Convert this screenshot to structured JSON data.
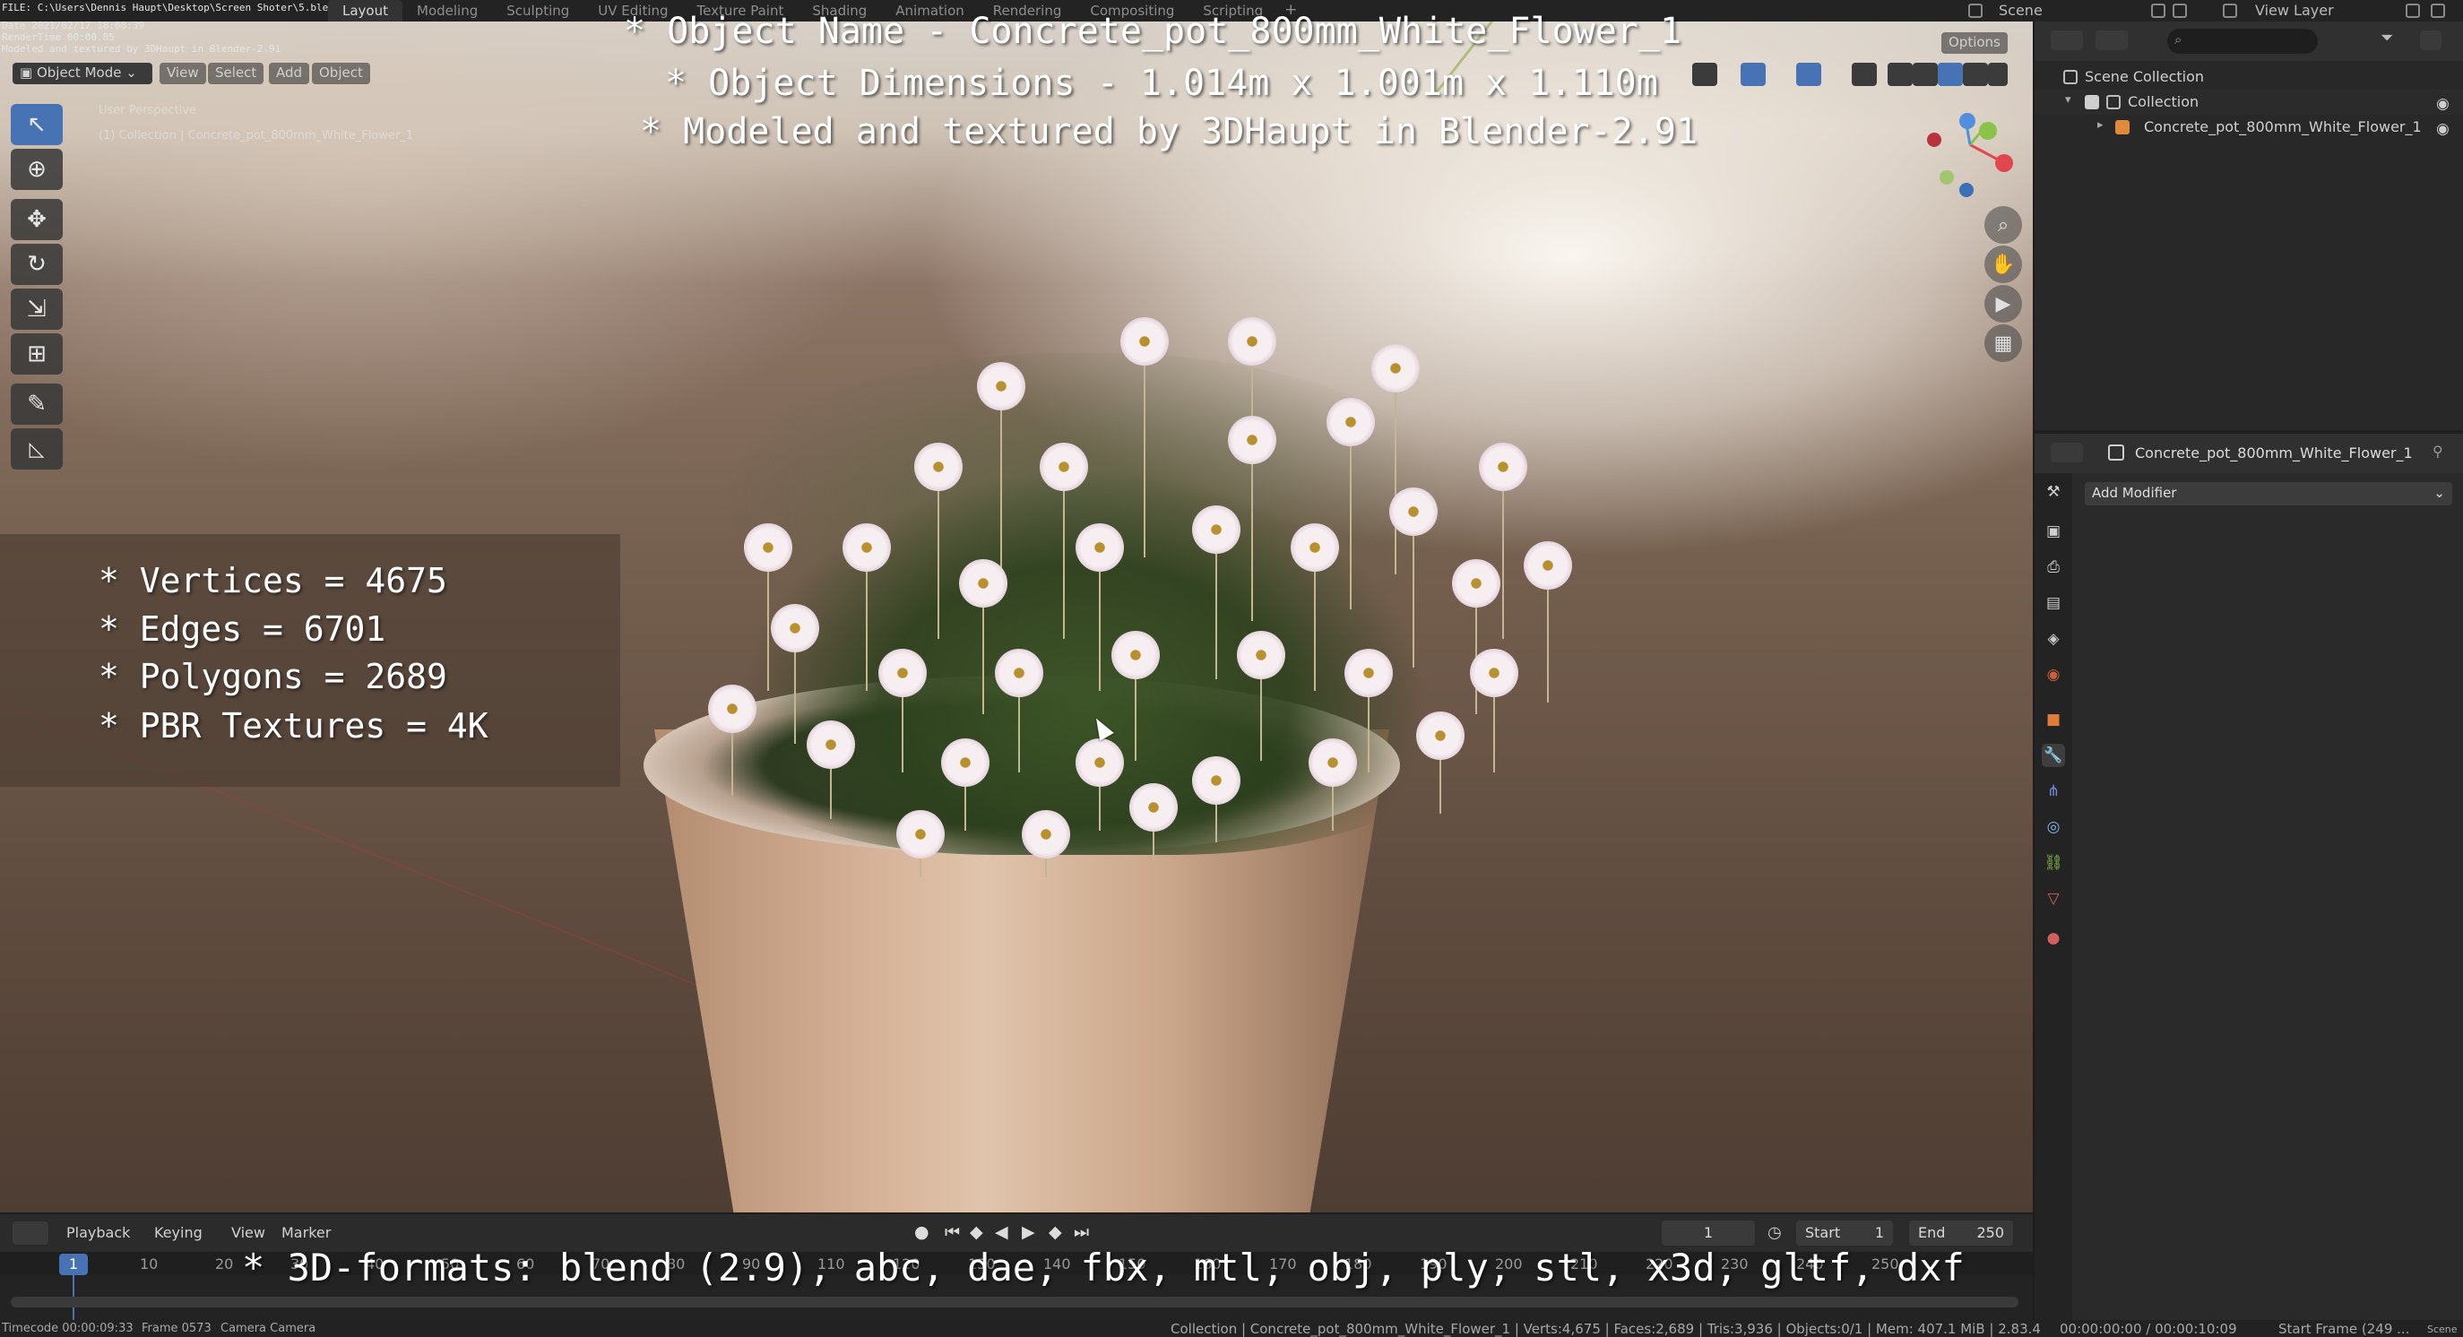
{
  "topbar": {
    "file_info": [
      "FILE: C:\\Users\\Dennis Haupt\\Desktop\\Screen Shoter\\5.blend",
      "Date 2021/02/17 18:08:39",
      "RenderTime 00:00.85",
      "Modeled and textured by 3DHaupt in Blender-2.91"
    ],
    "workspaces": [
      "Layout",
      "Modeling",
      "Sculpting",
      "UV Editing",
      "Texture Paint",
      "Shading",
      "Animation",
      "Rendering",
      "Compositing",
      "Scripting"
    ],
    "active_workspace": "Layout",
    "add_workspace": "+",
    "scene": "Scene",
    "view_layer": "View Layer"
  },
  "viewport": {
    "mode": "Object Mode",
    "menus": [
      "View",
      "Select",
      "Add",
      "Object"
    ],
    "options": "Options",
    "perspective_label": "User Perspective",
    "collection_label": "(1) Collection | Concrete_pot_800mm_White_Flower_1"
  },
  "overlay": {
    "title": "* Object Name - Concrete_pot_800mm_White_Flower_1",
    "dimensions": "* Object Dimensions -  1.014m x 1.001m x 1.110m",
    "credit": "* Modeled and textured by 3DHaupt in Blender-2.91",
    "stats": [
      "* Vertices = 4675",
      "* Edges = 6701",
      "* Polygons = 2689",
      "* PBR Textures = 4K"
    ],
    "formats": "* 3D-formats: blend (2.9), abc, dae, fbx, mtl, obj, ply, stl, x3d, gltf, dxf"
  },
  "toolbar": {
    "tools": [
      {
        "name": "select-box-tool",
        "icon": "↖"
      },
      {
        "name": "cursor-tool",
        "icon": "⊕"
      },
      {
        "name": "move-tool",
        "icon": "✥"
      },
      {
        "name": "rotate-tool",
        "icon": "↻"
      },
      {
        "name": "scale-tool",
        "icon": "⇲"
      },
      {
        "name": "transform-tool",
        "icon": "⊞"
      },
      {
        "name": "annotate-tool",
        "icon": "✎"
      },
      {
        "name": "measure-tool",
        "icon": "📐"
      }
    ]
  },
  "outliner": {
    "rows": [
      {
        "label": "Scene Collection",
        "indent": 0
      },
      {
        "label": "Collection",
        "indent": 1
      },
      {
        "label": "Concrete_pot_800mm_White_Flower_1",
        "indent": 2
      }
    ]
  },
  "properties": {
    "object_name": "Concrete_pot_800mm_White_Flower_1",
    "add_modifier": "Add Modifier",
    "tab_colors": [
      "#cfcfcf",
      "#cfcfcf",
      "#cfcfcf",
      "#cfcfcf",
      "#cfcfcf",
      "#c8603c",
      "#e07b39",
      "#4f9fde",
      "#6d8ce0",
      "#7fb4e8",
      "#8bc34a",
      "#d06060",
      "#d06060"
    ]
  },
  "timeline": {
    "menus": [
      "Playback",
      "Keying",
      "View",
      "Marker"
    ],
    "current_frame": "1",
    "start_label": "Start",
    "start": "1",
    "end_label": "End",
    "end": "250",
    "ticks": [
      "10",
      "20",
      "30",
      "40",
      "50",
      "60",
      "70",
      "80",
      "90",
      "110",
      "120",
      "130",
      "140",
      "150",
      "160",
      "170",
      "180",
      "190",
      "200",
      "210",
      "220",
      "230",
      "240",
      "250"
    ],
    "playhead": "1"
  },
  "statusbar": {
    "timecode": "Timecode 00:00:09:33",
    "frame": "Frame 0573",
    "camera": "Camera Camera",
    "info": "Collection | Concrete_pot_800mm_White_Flower_1 | Verts:4,675 | Faces:2,689 | Tris:3,936 | Objects:0/1 | Mem: 407.1 MiB | 2.83.4",
    "time": "00:00:00:00 / 00:00:10:09",
    "start_frame": "Start Frame (249 ...",
    "scene": "Scene"
  },
  "colors": {
    "accent": "#4772b3",
    "axis_x": "#e0474f",
    "axis_y": "#8bc34a",
    "axis_z": "#4f8fde"
  }
}
